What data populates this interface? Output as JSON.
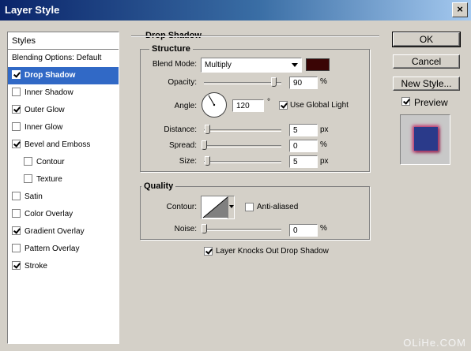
{
  "window": {
    "title": "Layer Style",
    "close_glyph": "×"
  },
  "styles_panel": {
    "header": "Styles",
    "items": [
      {
        "label": "Blending Options: Default",
        "checkbox": false,
        "checked": false,
        "selected": false,
        "indent": false
      },
      {
        "label": "Drop Shadow",
        "checkbox": true,
        "checked": true,
        "selected": true,
        "indent": false
      },
      {
        "label": "Inner Shadow",
        "checkbox": true,
        "checked": false,
        "selected": false,
        "indent": false
      },
      {
        "label": "Outer Glow",
        "checkbox": true,
        "checked": true,
        "selected": false,
        "indent": false
      },
      {
        "label": "Inner Glow",
        "checkbox": true,
        "checked": false,
        "selected": false,
        "indent": false
      },
      {
        "label": "Bevel and Emboss",
        "checkbox": true,
        "checked": true,
        "selected": false,
        "indent": false
      },
      {
        "label": "Contour",
        "checkbox": true,
        "checked": false,
        "selected": false,
        "indent": true
      },
      {
        "label": "Texture",
        "checkbox": true,
        "checked": false,
        "selected": false,
        "indent": true
      },
      {
        "label": "Satin",
        "checkbox": true,
        "checked": false,
        "selected": false,
        "indent": false
      },
      {
        "label": "Color Overlay",
        "checkbox": true,
        "checked": false,
        "selected": false,
        "indent": false
      },
      {
        "label": "Gradient Overlay",
        "checkbox": true,
        "checked": true,
        "selected": false,
        "indent": false
      },
      {
        "label": "Pattern Overlay",
        "checkbox": true,
        "checked": false,
        "selected": false,
        "indent": false
      },
      {
        "label": "Stroke",
        "checkbox": true,
        "checked": true,
        "selected": false,
        "indent": false
      }
    ]
  },
  "drop_shadow": {
    "group_title": "Drop Shadow",
    "structure": {
      "title": "Structure",
      "blend_mode_label": "Blend Mode:",
      "blend_mode_value": "Multiply",
      "shadow_color": "#3a0505",
      "opacity_label": "Opacity:",
      "opacity_value": "90",
      "opacity_fraction": 0.9,
      "opacity_unit": "%",
      "angle_label": "Angle:",
      "angle_value": "120",
      "angle_degrees": 120,
      "angle_unit": "°",
      "use_global_light_label": "Use Global Light",
      "use_global_light_checked": true,
      "distance_label": "Distance:",
      "distance_value": "5",
      "distance_unit": "px",
      "spread_label": "Spread:",
      "spread_value": "0",
      "spread_unit": "%",
      "size_label": "Size:",
      "size_value": "5",
      "size_unit": "px"
    },
    "quality": {
      "title": "Quality",
      "contour_label": "Contour:",
      "anti_aliased_label": "Anti-aliased",
      "anti_aliased_checked": false,
      "noise_label": "Noise:",
      "noise_value": "0",
      "noise_unit": "%"
    },
    "knocks_out_label": "Layer Knocks Out Drop Shadow",
    "knocks_out_checked": true
  },
  "buttons": {
    "ok": "OK",
    "cancel": "Cancel",
    "new_style": "New Style...",
    "preview_label": "Preview",
    "preview_checked": true
  },
  "colors": {
    "selected_row": "#3169c6",
    "dialog_bg": "#d4d0c8",
    "preview_fill": "#2a3a8a",
    "preview_glow": "#c0306a"
  },
  "watermark": "OLiHe.COM"
}
